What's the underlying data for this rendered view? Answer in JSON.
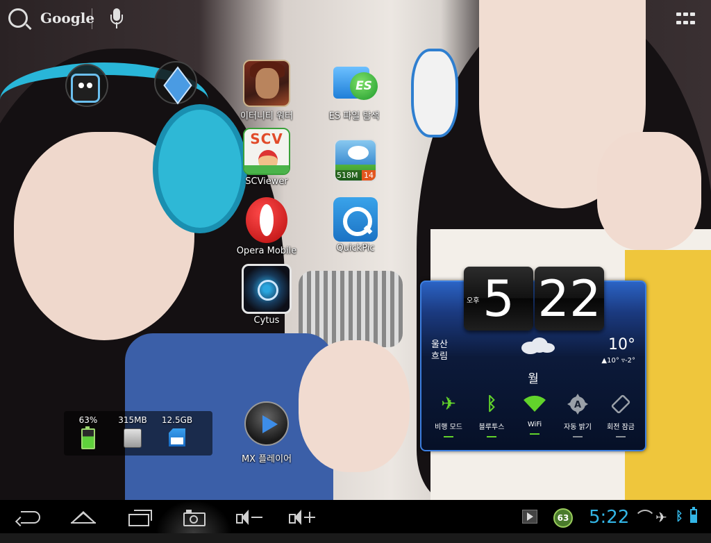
{
  "search": {
    "label": "Google"
  },
  "apps": {
    "infinity": {
      "label": "이터니티 워터"
    },
    "es": {
      "label": "ES 파일 탐색",
      "badge_text": "ES"
    },
    "scv": {
      "label": "SCViewer",
      "icon_text": "SCV"
    },
    "weather": {
      "label": "",
      "memory": "518M",
      "count": "14"
    },
    "opera": {
      "label": "Opera Mobile"
    },
    "quickpic": {
      "label": "QuickPic"
    },
    "cytus": {
      "label": "Cytus"
    },
    "mx": {
      "label": "MX 플레이어"
    }
  },
  "storage": {
    "battery": "63%",
    "ram": "315MB",
    "sd": "12.5GB"
  },
  "widget": {
    "hour": "5",
    "minute": "22",
    "ampm": "오후",
    "city": "울산",
    "condition": "흐림",
    "temp": "10°",
    "range": "▲10° ▿-2°",
    "day": "월",
    "toggles": [
      {
        "label": "비행 모드",
        "state": "on"
      },
      {
        "label": "블루투스",
        "state": "on"
      },
      {
        "label": "WiFi",
        "state": "on"
      },
      {
        "label": "자동 밝기",
        "state": "off"
      },
      {
        "label": "회전 잠금",
        "state": "off"
      }
    ]
  },
  "statusbar": {
    "time": "5:22",
    "badge": "63"
  },
  "colors": {
    "accent": "#33b5e5",
    "toggle_on": "#62d32b",
    "widget_border": "#3d7fe0"
  },
  "icons": {
    "search": "search-icon",
    "mic": "microphone-icon",
    "all_apps": "all-apps-grid-icon",
    "back": "back-icon",
    "home": "home-icon",
    "recent": "recent-apps-icon",
    "screenshot": "camera-icon",
    "volume_down": "volume-down-icon",
    "volume_up": "volume-up-icon"
  }
}
